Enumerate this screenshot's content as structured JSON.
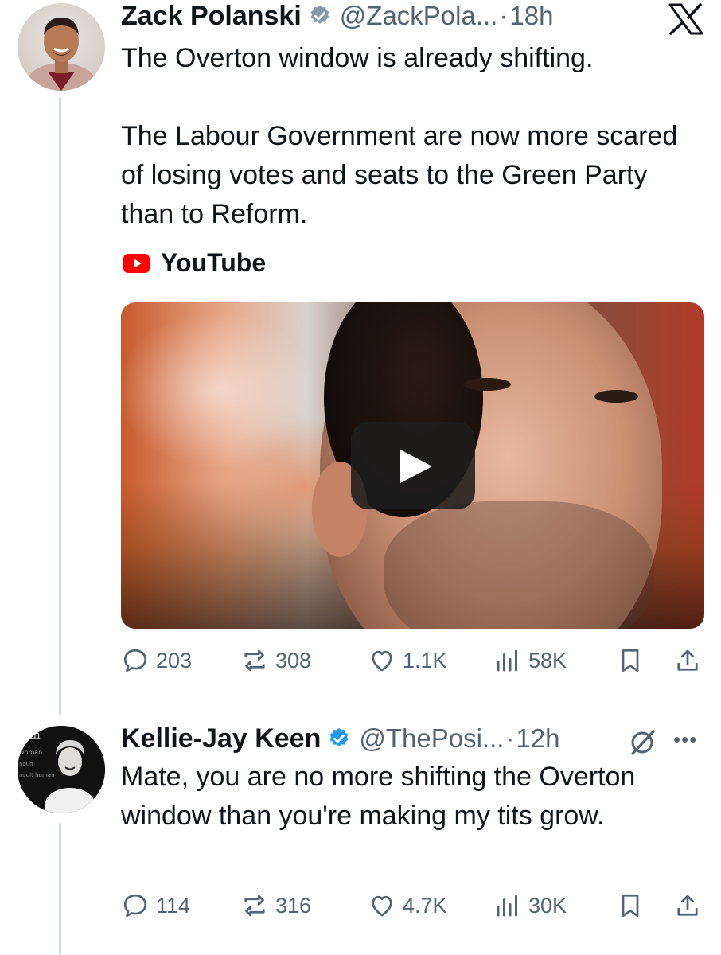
{
  "posts": [
    {
      "author": {
        "display_name": "Zack Polanski",
        "verified": true,
        "handle": "@ZackPola...",
        "time": "18h"
      },
      "text": "The Overton window is already shifting.\n\nThe Labour Government are now more scared of losing votes and seats to the Green Party than to Reform.",
      "link_source": "YouTube",
      "actions": {
        "replies": "203",
        "reposts": "308",
        "likes": "1.1K",
        "views": "58K"
      }
    },
    {
      "author": {
        "display_name": "Kellie-Jay Keen",
        "verified": true,
        "handle": "@ThePosi...",
        "time": "12h"
      },
      "text": "Mate, you are no more shifting the Overton window than you're making my tits grow.",
      "actions": {
        "replies": "114",
        "reposts": "316",
        "likes": "4.7K",
        "views": "30K"
      }
    }
  ],
  "separator": "·",
  "icons": {
    "platform": "x-logo-icon",
    "verified": "verified-badge-icon",
    "reply": "reply-icon",
    "repost": "repost-icon",
    "like": "heart-icon",
    "views": "views-chart-icon",
    "bookmark": "bookmark-icon",
    "share": "share-icon",
    "grok": "grok-icon",
    "more": "more-icon"
  },
  "colors": {
    "text": "#0f1419",
    "secondary": "#536471",
    "verified": "#1d9bf0",
    "youtube": "#ff0000",
    "thread_line": "#cfd9de"
  }
}
